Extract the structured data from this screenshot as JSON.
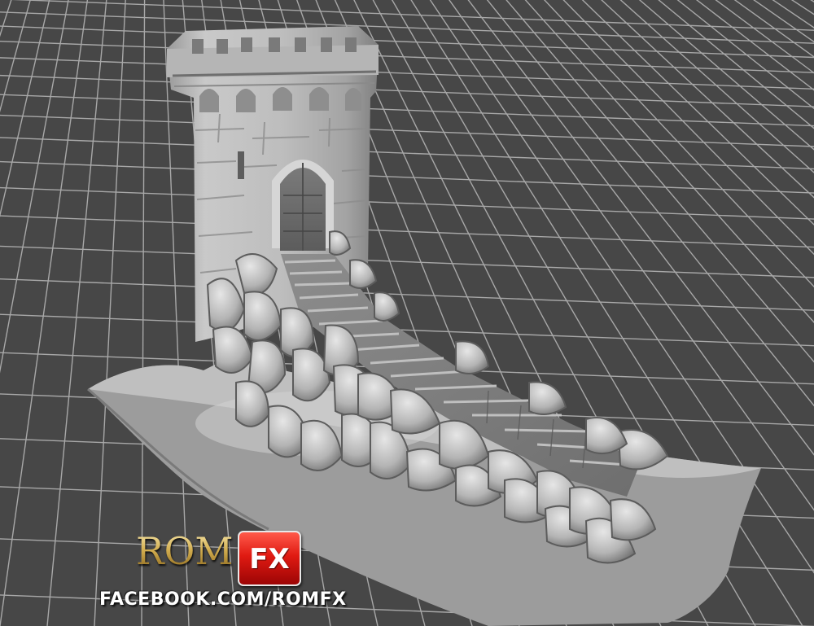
{
  "viewport": {
    "background_color": "#474747",
    "grid_color": "#a8a8a8",
    "model_color": "#c8c8c8"
  },
  "scene": {
    "object": "dice-tower-castle-model"
  },
  "logo": {
    "rom_text": "ROM",
    "fx_text": "FX",
    "url_text": "FACEBOOK.COM/ROMFX",
    "gold_color": "#d6b85e",
    "red_color": "#e01a12"
  }
}
